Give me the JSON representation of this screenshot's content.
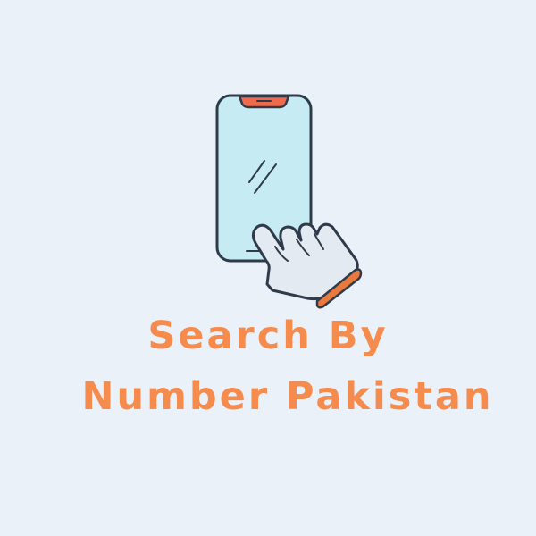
{
  "title": {
    "line_1": "Search By",
    "line_2": "Number Pakistan"
  },
  "illustration": {
    "phone_icon": "smartphone-icon",
    "hand_icon": "tapping-hand-icon"
  },
  "colors": {
    "background": "#ebf1f9",
    "title": "#f68b4e",
    "phone_screen": "#c6ebf2",
    "outline": "#2f3b4b",
    "notch": "#f06a4d",
    "cuff": "#e9793c",
    "glove": "#e4eaf1"
  }
}
